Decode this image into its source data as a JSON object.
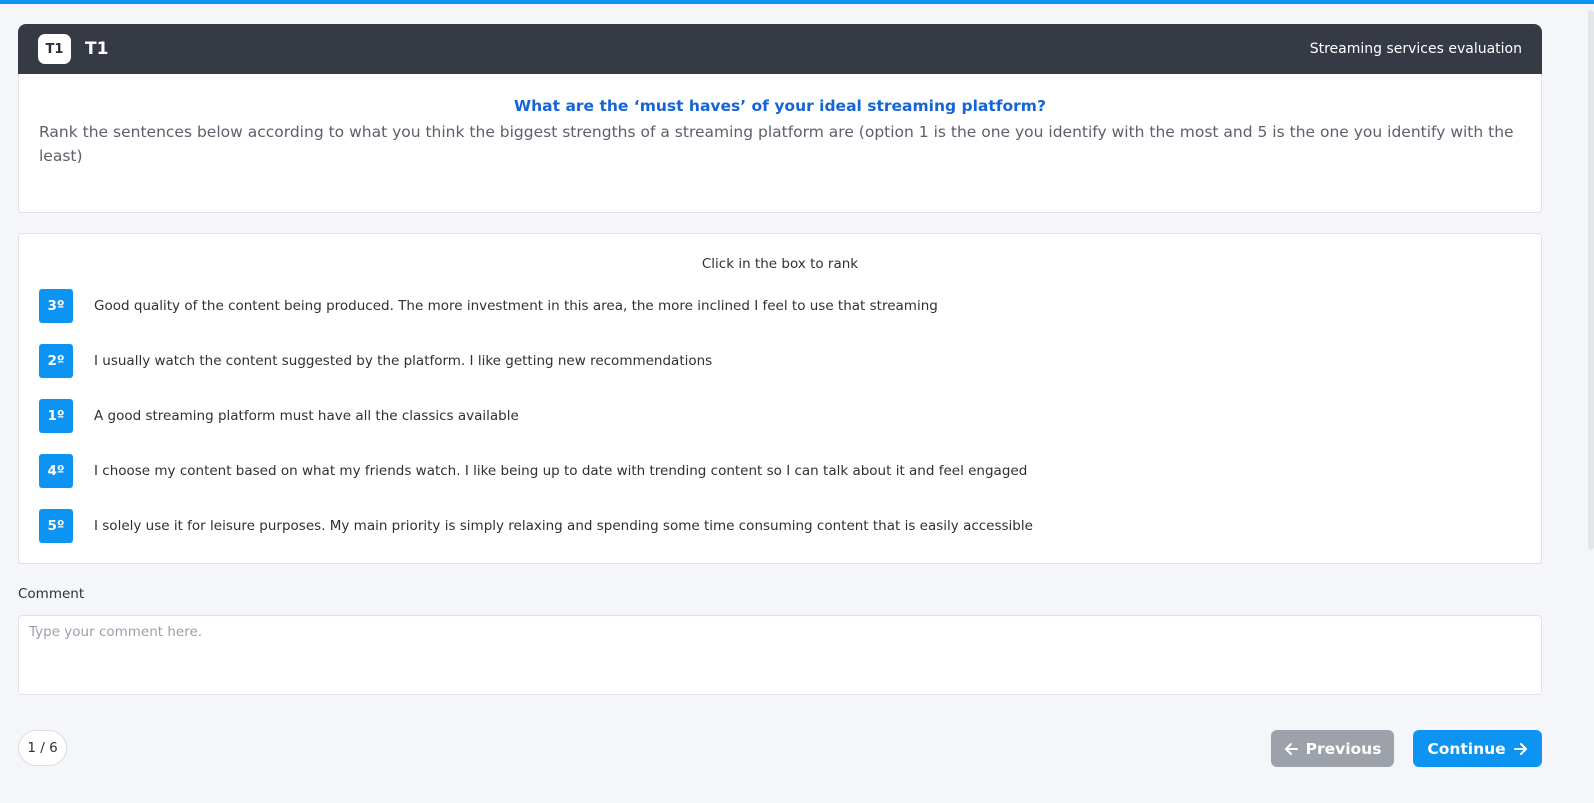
{
  "header": {
    "badge": "T1",
    "title": "T1",
    "right_text": "Streaming services evaluation"
  },
  "question": {
    "title": "What are the ‘must haves’ of your ideal streaming platform?",
    "description": "Rank the sentences below according to what you think the biggest strengths of a streaming platform are (option 1 is the one you identify with the most and 5 is the one you identify with the least)"
  },
  "ranking": {
    "hint": "Click in the box to rank",
    "items": [
      {
        "rank": "3º",
        "text": "Good quality of the content being produced. The more investment in this area, the more inclined I feel to use that streaming"
      },
      {
        "rank": "2º",
        "text": "I usually watch the content suggested by the platform. I like getting new recommendations"
      },
      {
        "rank": "1º",
        "text": "A good streaming platform must have all the classics available"
      },
      {
        "rank": "4º",
        "text": "I choose my content based on what my friends watch. I like being up to date with trending content so I can talk about it and feel engaged"
      },
      {
        "rank": "5º",
        "text": "I solely use it for leisure purposes. My main priority is simply relaxing and spending some time consuming content that is easily accessible"
      }
    ]
  },
  "comment": {
    "label": "Comment",
    "placeholder": "Type your comment here.",
    "value": ""
  },
  "footer": {
    "page_indicator": "1 / 6",
    "previous_label": "Previous",
    "continue_label": "Continue"
  },
  "colors": {
    "accent": "#0d93f2",
    "header_bg": "#363a45",
    "question_title": "#1565d8",
    "previous_bg": "#9da1a9"
  }
}
